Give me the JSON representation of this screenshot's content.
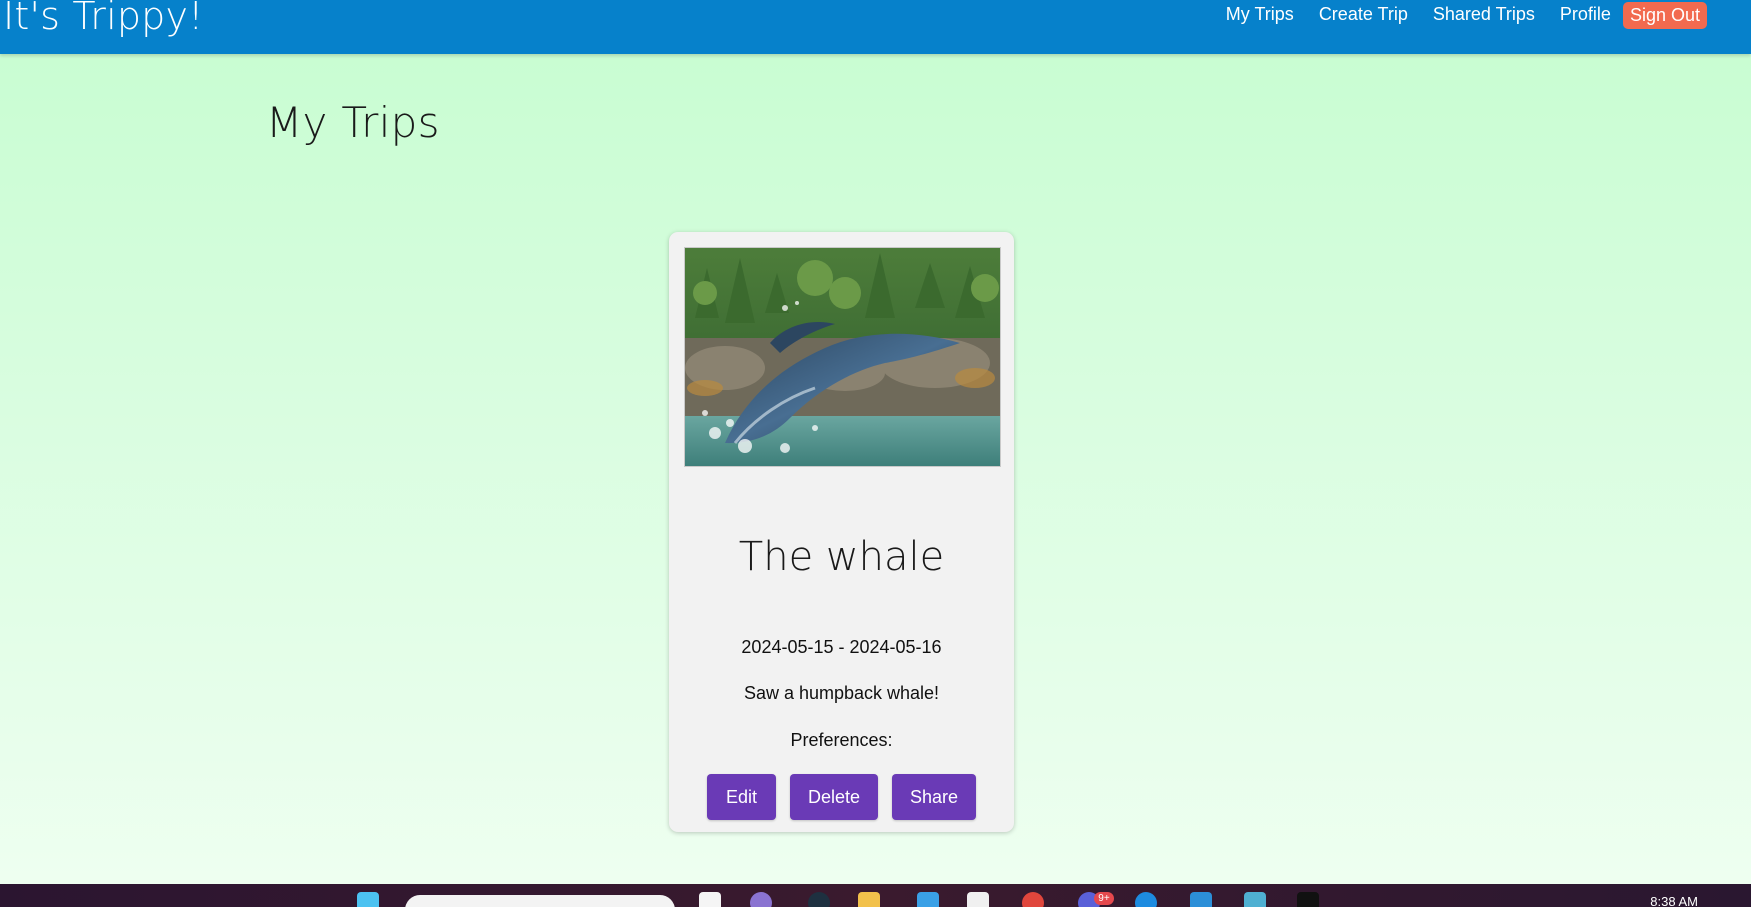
{
  "navbar": {
    "brand": "It's Trippy!",
    "links": [
      {
        "label": "My Trips"
      },
      {
        "label": "Create Trip"
      },
      {
        "label": "Shared Trips"
      },
      {
        "label": "Profile"
      }
    ],
    "sign_out_label": "Sign Out",
    "color": "#0681cb",
    "sign_out_color": "#f26a4f"
  },
  "page": {
    "title": "My Trips"
  },
  "trips": [
    {
      "title": "The whale",
      "dates": "2024-05-15 - 2024-05-16",
      "description": "Saw a humpback whale!",
      "preferences_label": "Preferences:",
      "actions": {
        "edit_label": "Edit",
        "delete_label": "Delete",
        "share_label": "Share"
      }
    }
  ],
  "taskbar": {
    "clock": "8:38 AM",
    "notification_badge": "9+"
  },
  "colors": {
    "button": "#6a3ab6",
    "background_top": "#c6fdd0",
    "background_bottom": "#effff1"
  }
}
